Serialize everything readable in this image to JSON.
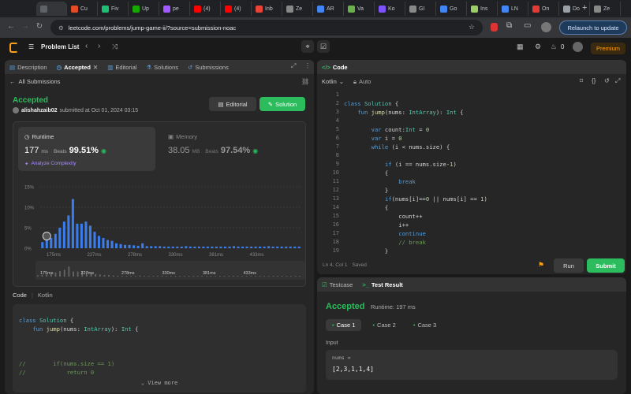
{
  "browser": {
    "tabs": [
      {
        "label": "",
        "color": "#5f6368"
      },
      {
        "label": "Cu",
        "color": "#e34c26"
      },
      {
        "label": "Fiv",
        "color": "#1dbf73"
      },
      {
        "label": "Up",
        "color": "#14a800"
      },
      {
        "label": "pe",
        "color": "#a259ff"
      },
      {
        "label": "(4)",
        "color": "#ff0000"
      },
      {
        "label": "(4)",
        "color": "#ff0000"
      },
      {
        "label": "Inb",
        "color": "#ea4335"
      },
      {
        "label": "Ze",
        "color": "#888888"
      },
      {
        "label": "AR",
        "color": "#4285f4"
      },
      {
        "label": "Va",
        "color": "#6ab04c"
      },
      {
        "label": "Ko",
        "color": "#7f52ff"
      },
      {
        "label": "GI",
        "color": "#888888"
      },
      {
        "label": "Go",
        "color": "#4285f4"
      },
      {
        "label": "Ins",
        "color": "#9ccc65"
      },
      {
        "label": "LN",
        "color": "#4285f4"
      },
      {
        "label": "On",
        "color": "#e53935"
      },
      {
        "label": "Do",
        "color": "#9aa0a6"
      },
      {
        "label": "Ze",
        "color": "#888888"
      }
    ],
    "url": "leetcode.com/problems/jump-game-ii/?source=submission-noac",
    "relaunch": "Relaunch to update"
  },
  "nav": {
    "problem_list": "Problem List",
    "streak": "0",
    "premium": "Premium"
  },
  "left": {
    "tabs": {
      "description": "Description",
      "accepted": "Accepted",
      "editorial": "Editorial",
      "solutions": "Solutions",
      "submissions": "Submissions"
    },
    "back": "All Submissions",
    "status": "Accepted",
    "user": "alishahzaib02",
    "submitted": "submitted at Oct 01, 2024 03:15",
    "editorial_btn": "Editorial",
    "solution_btn": "Solution",
    "runtime_label": "Runtime",
    "runtime_value": "177",
    "runtime_unit": "ms",
    "beats_label": "Beats",
    "runtime_beats": "99.51%",
    "analyze": "Analyze Complexity",
    "memory_label": "Memory",
    "memory_value": "38.05",
    "memory_unit": "MB",
    "memory_beats": "97.54%",
    "code_label": "Code",
    "code_lang": "Kotlin",
    "code_lines": [
      "class Solution {",
      "    fun jump(nums: IntArray): Int {",
      "",
      "",
      "",
      "//        if(nums.size == 1)",
      "//            return 0"
    ],
    "view_more": "View more"
  },
  "chart_data": {
    "type": "bar",
    "title": "",
    "xlabel": "",
    "ylabel": "",
    "y_ticks": [
      "15%",
      "10%",
      "5%",
      "0%"
    ],
    "ylim": [
      0,
      15
    ],
    "x_ticks": [
      "175ms",
      "227ms",
      "278ms",
      "330ms",
      "381ms",
      "433ms"
    ],
    "values": [
      1.5,
      2,
      2.5,
      3.5,
      5,
      6.5,
      8,
      12,
      6,
      6,
      6.5,
      5.5,
      4,
      3,
      2.5,
      2,
      1.8,
      1.2,
      1,
      0.8,
      0.8,
      0.7,
      0.6,
      1.2,
      0.5,
      0.5,
      0.5,
      0.5,
      0.4,
      0.4,
      0.4,
      0.4,
      0.4,
      0.5,
      0.4,
      0.4,
      0.4,
      0.4,
      0.4,
      0.4,
      0.4,
      0.4,
      0.4,
      0.4,
      0.5,
      0.4,
      0.4,
      0.4,
      0.4,
      0.4,
      0.4,
      0.4,
      0.5,
      0.4,
      0.4,
      0.4,
      0.4,
      0.4,
      0.4,
      0.4
    ],
    "highlight_index": 1,
    "color": "#3b82f6",
    "minimap_ticks": [
      "175ms",
      "227ms",
      "278ms",
      "330ms",
      "381ms",
      "433ms"
    ]
  },
  "editor": {
    "title": "Code",
    "lang": "Kotlin",
    "auto": "Auto",
    "lines": [
      "",
      "class Solution {",
      "    fun jump(nums: IntArray): Int {",
      "",
      "        var count:Int = 0",
      "        var i = 0",
      "        while (i < nums.size) {",
      "",
      "            if (i == nums.size-1)",
      "            {",
      "                break",
      "            }",
      "            if(nums[i]==0 || nums[i] == 1)",
      "            {",
      "                count++",
      "                i++",
      "                continue",
      "                // break",
      "            }"
    ],
    "status_pos": "Ln 4, Col 1",
    "status_saved": "Saved",
    "run": "Run",
    "submit": "Submit"
  },
  "result": {
    "testcase_tab": "Testcase",
    "result_tab": "Test Result",
    "status": "Accepted",
    "runtime": "Runtime: 197 ms",
    "cases": [
      "Case 1",
      "Case 2",
      "Case 3"
    ],
    "input_label": "Input",
    "param": "nums =",
    "value": "[2,3,1,1,4]"
  }
}
